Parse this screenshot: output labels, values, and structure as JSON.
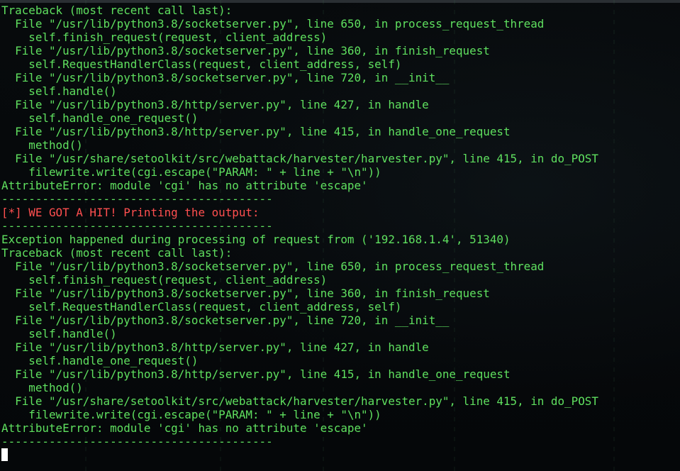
{
  "terminal": {
    "lines": [
      {
        "text": "Traceback (most recent call last):",
        "kind": "normal"
      },
      {
        "text": "  File \"/usr/lib/python3.8/socketserver.py\", line 650, in process_request_thread",
        "kind": "normal"
      },
      {
        "text": "    self.finish_request(request, client_address)",
        "kind": "normal"
      },
      {
        "text": "  File \"/usr/lib/python3.8/socketserver.py\", line 360, in finish_request",
        "kind": "normal"
      },
      {
        "text": "    self.RequestHandlerClass(request, client_address, self)",
        "kind": "normal"
      },
      {
        "text": "  File \"/usr/lib/python3.8/socketserver.py\", line 720, in __init__",
        "kind": "normal"
      },
      {
        "text": "    self.handle()",
        "kind": "normal"
      },
      {
        "text": "  File \"/usr/lib/python3.8/http/server.py\", line 427, in handle",
        "kind": "normal"
      },
      {
        "text": "    self.handle_one_request()",
        "kind": "normal"
      },
      {
        "text": "  File \"/usr/lib/python3.8/http/server.py\", line 415, in handle_one_request",
        "kind": "normal"
      },
      {
        "text": "    method()",
        "kind": "normal"
      },
      {
        "text": "  File \"/usr/share/setoolkit/src/webattack/harvester/harvester.py\", line 415, in do_POST",
        "kind": "normal"
      },
      {
        "text": "    filewrite.write(cgi.escape(\"PARAM: \" + line + \"\\n\"))",
        "kind": "normal"
      },
      {
        "text": "AttributeError: module 'cgi' has no attribute 'escape'",
        "kind": "normal"
      },
      {
        "text": "----------------------------------------",
        "kind": "normal"
      },
      {
        "text": "[*] WE GOT A HIT! Printing the output:",
        "kind": "hit"
      },
      {
        "text": "----------------------------------------",
        "kind": "normal"
      },
      {
        "text": "Exception happened during processing of request from ('192.168.1.4', 51340)",
        "kind": "normal"
      },
      {
        "text": "Traceback (most recent call last):",
        "kind": "normal"
      },
      {
        "text": "  File \"/usr/lib/python3.8/socketserver.py\", line 650, in process_request_thread",
        "kind": "normal"
      },
      {
        "text": "    self.finish_request(request, client_address)",
        "kind": "normal"
      },
      {
        "text": "  File \"/usr/lib/python3.8/socketserver.py\", line 360, in finish_request",
        "kind": "normal"
      },
      {
        "text": "    self.RequestHandlerClass(request, client_address, self)",
        "kind": "normal"
      },
      {
        "text": "  File \"/usr/lib/python3.8/socketserver.py\", line 720, in __init__",
        "kind": "normal"
      },
      {
        "text": "    self.handle()",
        "kind": "normal"
      },
      {
        "text": "  File \"/usr/lib/python3.8/http/server.py\", line 427, in handle",
        "kind": "normal"
      },
      {
        "text": "    self.handle_one_request()",
        "kind": "normal"
      },
      {
        "text": "  File \"/usr/lib/python3.8/http/server.py\", line 415, in handle_one_request",
        "kind": "normal"
      },
      {
        "text": "    method()",
        "kind": "normal"
      },
      {
        "text": "  File \"/usr/share/setoolkit/src/webattack/harvester/harvester.py\", line 415, in do_POST",
        "kind": "normal"
      },
      {
        "text": "    filewrite.write(cgi.escape(\"PARAM: \" + line + \"\\n\"))",
        "kind": "normal"
      },
      {
        "text": "AttributeError: module 'cgi' has no attribute 'escape'",
        "kind": "normal"
      },
      {
        "text": "----------------------------------------",
        "kind": "normal"
      }
    ]
  },
  "colors": {
    "text": "#5fe05f",
    "hit": "#ff4f4f",
    "background": "#06080a",
    "cursor": "#ffffff"
  }
}
